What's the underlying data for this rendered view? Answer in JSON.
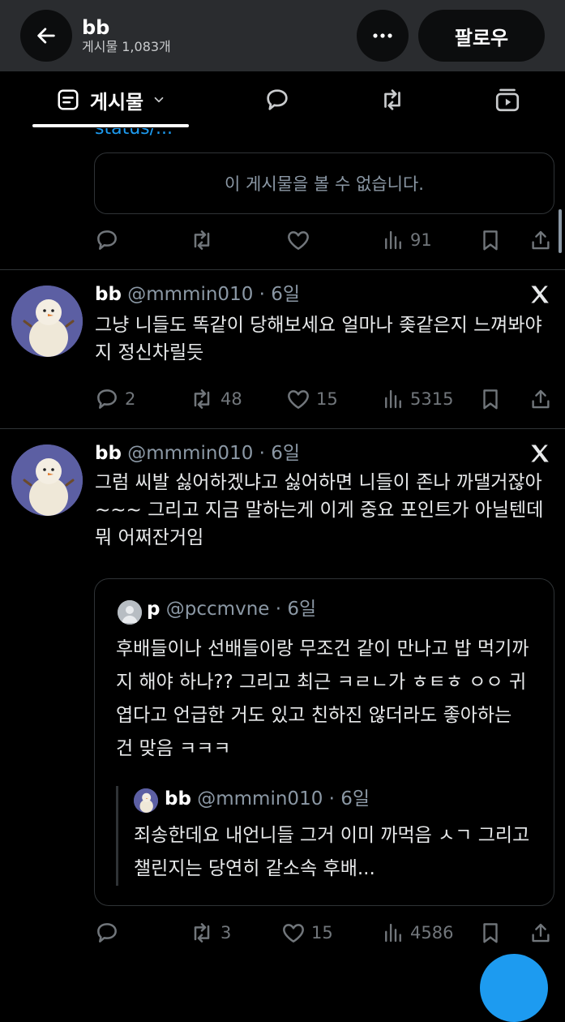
{
  "header": {
    "name": "bb",
    "post_count": "게시물 1,083개",
    "follow_label": "팔로우"
  },
  "tabs": {
    "posts_label": "게시물"
  },
  "feed": {
    "cut_link_text": "status/...",
    "unavailable_text": "이 게시물을 볼 수 없습니다.",
    "first_stats": {
      "views": "91"
    },
    "posts": [
      {
        "name": "bb",
        "handle": "@mmmin010",
        "time": "6일",
        "text": "그냥 니들도 똑같이 당해보세요 얼마나 좆같은지 느껴봐야지 정신차릴듯",
        "replies": "2",
        "reposts": "48",
        "likes": "15",
        "views": "5315"
      },
      {
        "name": "bb",
        "handle": "@mmmin010",
        "time": "6일",
        "text": "그럼 씨발 싫어하겠냐고 싫어하면 니들이 존나 까댈거잖아~~~ 그리고 지금 말하는게 이게 중요 포인트가 아닐텐데 뭐 어쩌잔거임",
        "replies": "",
        "reposts": "3",
        "likes": "15",
        "views": "4586",
        "quote": {
          "name": "p",
          "handle": "@pccmvne",
          "time": "6일",
          "text": "후배들이나 선배들이랑 무조건 같이 만나고 밥 먹기까지 해야 하나?? 그리고 최근 ㅋㄹㄴ가 ㅎㅌㅎ ㅇㅇ 귀엽다고 언급한 거도 있고 친하진 않더라도 좋아하는 건 맞음 ㅋㅋㅋ",
          "nested": {
            "name": "bb",
            "handle": "@mmmin010",
            "time": "6일",
            "text": "죄송한데요 내언니들 그거 이미 까먹음 ㅅㄱ 그리고 챌린지는 당연히 같소속 후배..."
          }
        }
      }
    ]
  },
  "colors": {
    "background": "#000000",
    "header_bg": "#2a2c2f",
    "accent": "#1d9bf0",
    "muted": "#71767b",
    "border": "#2f3336"
  }
}
